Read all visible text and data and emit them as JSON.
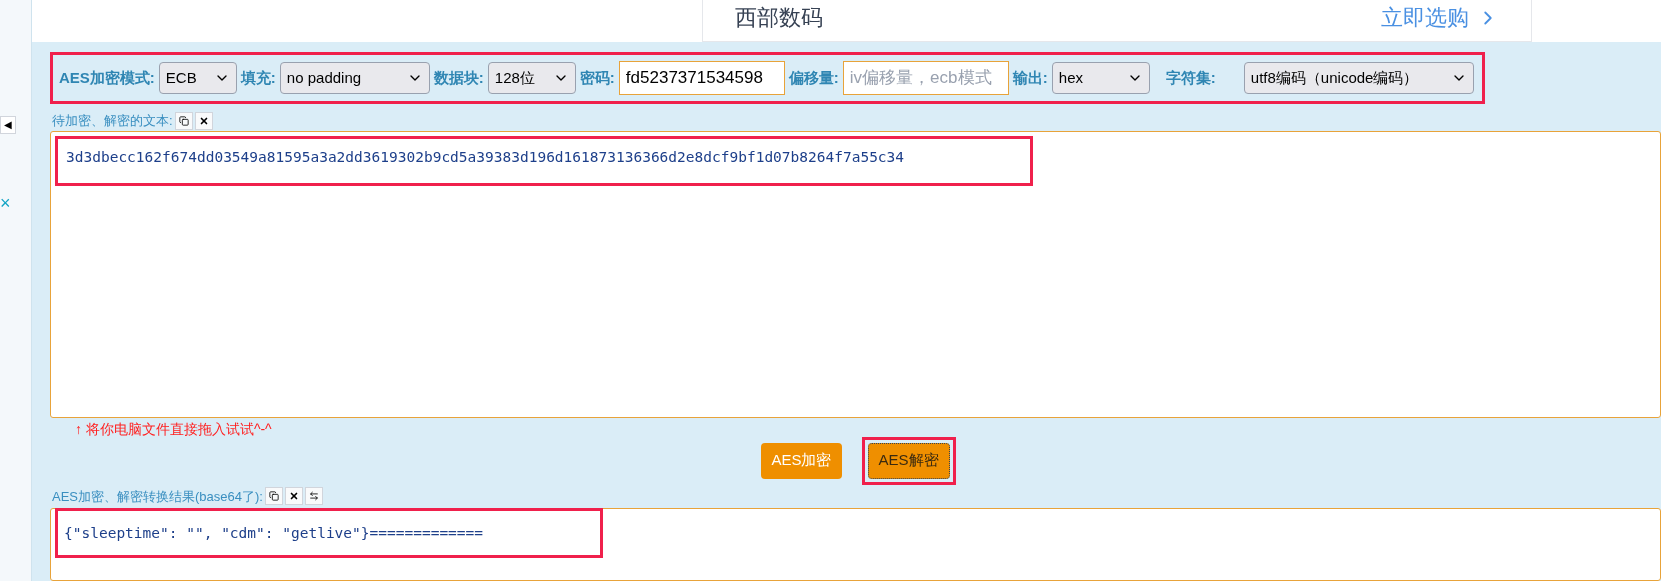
{
  "ad_card": {
    "title": "西部数码",
    "link": "立即选购"
  },
  "side": {
    "collapse_glyph": "◀",
    "close_glyph": "×"
  },
  "settings": [
    {
      "kind": "select",
      "label": "AES加密模式:",
      "value": "ECB"
    },
    {
      "kind": "select",
      "label": "填充:",
      "value": "no padding"
    },
    {
      "kind": "select",
      "label": "数据块:",
      "value": "128位"
    },
    {
      "kind": "input",
      "label": "密码:",
      "value": "fd5237371534598"
    },
    {
      "kind": "input",
      "label": "偏移量:",
      "placeholder": "iv偏移量，ecb模式"
    },
    {
      "kind": "select",
      "label": "输出:",
      "value": "hex"
    },
    {
      "kind": "select",
      "label": "字符集:",
      "value": "utf8编码（unicode编码）"
    }
  ],
  "input_label": "待加密、解密的文本:",
  "input_text": "3d3dbecc162f674dd03549a81595a3a2dd3619302b9cd5a39383d196d161873136366d2e8dcf9bf1d07b8264f7a55c34",
  "hint": "↑ 将你电脑文件直接拖入试试^-^",
  "buttons": [
    {
      "label": "AES加密",
      "selected": false
    },
    {
      "label": "AES解密",
      "selected": true
    }
  ],
  "result_label": "AES加密、解密转换结果(base64了):",
  "result_text": "{\"sleeptime\": \"\", \"cdm\": \"getlive\"}============="
}
